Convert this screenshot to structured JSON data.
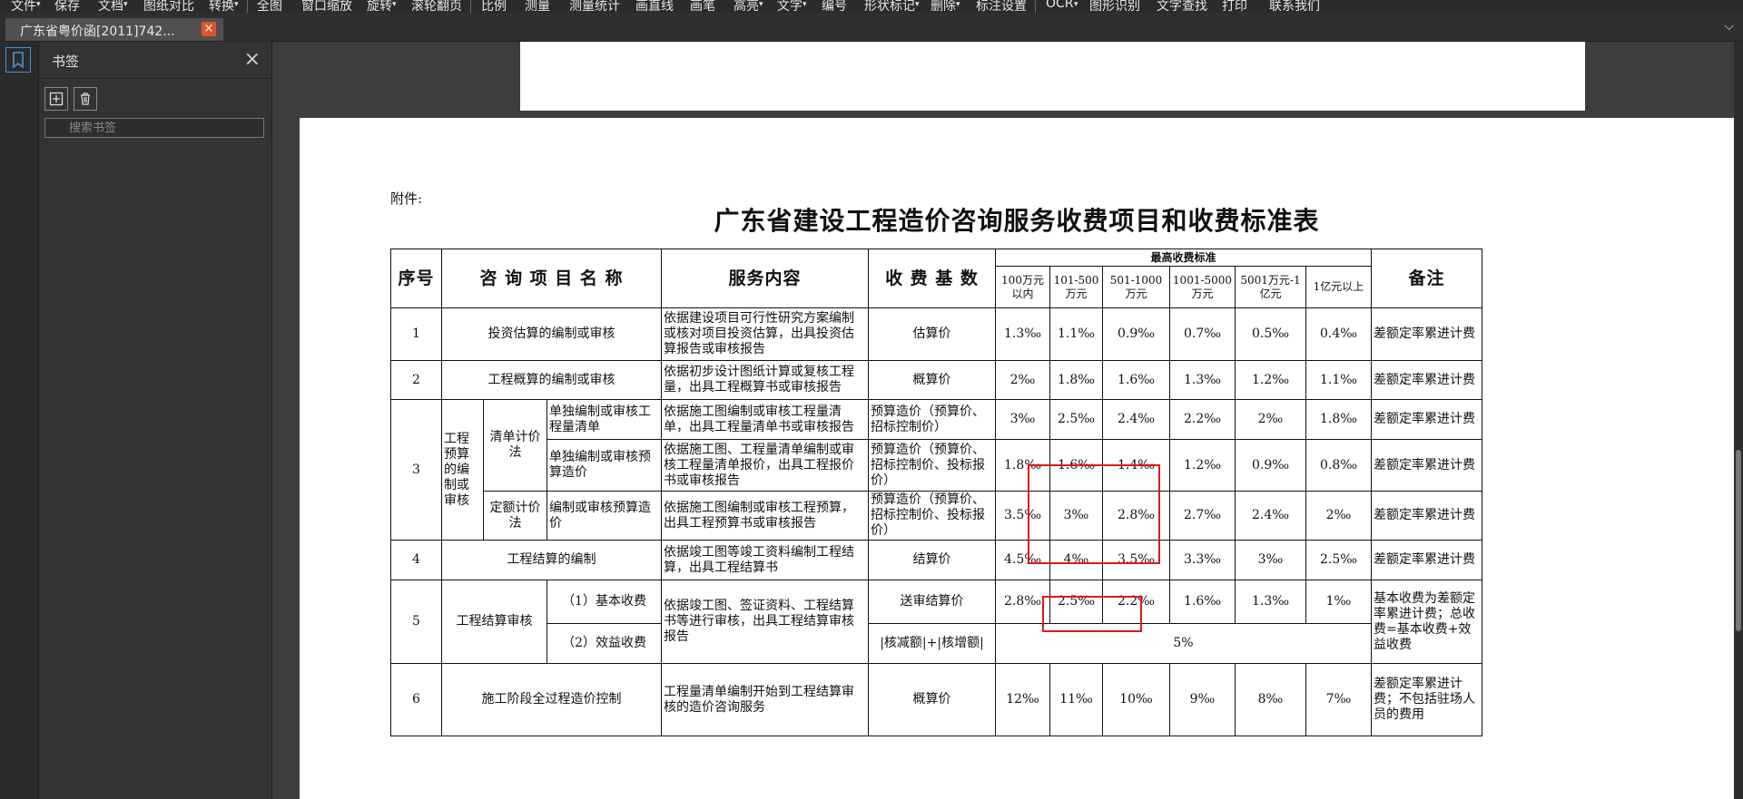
{
  "menu": [
    "文件",
    "保存",
    "文档",
    "图纸对比",
    "转换",
    "全图",
    "窗口缩放",
    "旋转",
    "滚轮翻页",
    "比例",
    "测量",
    "测量统计",
    "画直线",
    "画笔",
    "高亮",
    "文字",
    "编号",
    "形状标记",
    "删除",
    "标注设置",
    "OCR",
    "图形识别",
    "文字查找",
    "打印",
    "联系我们"
  ],
  "tab": {
    "title": "广东省粤价函[2011]742...",
    "close": "×"
  },
  "bookmark_panel": {
    "title": "书签",
    "close": "×",
    "search_placeholder": "搜索书签"
  },
  "document": {
    "attachment_label": "附件:",
    "title": "广东省建设工程造价咨询服务收费项目和收费标准表",
    "header": {
      "no": "序号",
      "item": "咨 询 项 目 名 称",
      "service": "服务内容",
      "base": "收 费 基 数",
      "max_std": "最高收费标准",
      "tiers": [
        "100万元以内",
        "101-500万元",
        "501-1000万元",
        "1001-5000万元",
        "5001万元-1亿元",
        "1亿元以上"
      ],
      "remark": "备注"
    },
    "rows": {
      "r1": {
        "no": "1",
        "item": "投资估算的编制或审核",
        "service": "依据建设项目可行性研究方案编制或核对项目投资估算，出具投资估算报告或审核报告",
        "base": "估算价",
        "rates": [
          "1.3‰",
          "1.1‰",
          "0.9‰",
          "0.7‰",
          "0.5‰",
          "0.4‰"
        ],
        "remark": "差额定率累进计费"
      },
      "r2": {
        "no": "2",
        "item": "工程概算的编制或审核",
        "service": "依据初步设计图纸计算或复核工程量，出具工程概算书或审核报告",
        "base": "概算价",
        "rates": [
          "2‰",
          "1.8‰",
          "1.6‰",
          "1.3‰",
          "1.2‰",
          "1.1‰"
        ],
        "remark": "差额定率累进计费"
      },
      "r3": {
        "no": "3",
        "group": "工程预算的编制或审核",
        "method1": "清单计价法",
        "method2": "定额计价法",
        "a": {
          "sub": "单独编制或审核工程量清单",
          "service": "依据施工图编制或审核工程量清单，出具工程量清单书或审核报告",
          "base": "预算造价（预算价、招标控制价）",
          "rates": [
            "3‰",
            "2.5‰",
            "2.4‰",
            "2.2‰",
            "2‰",
            "1.8‰"
          ],
          "remark": "差额定率累进计费"
        },
        "b": {
          "sub": "单独编制或审核预算造价",
          "service": "依据施工图、工程量清单编制或审核工程量清单报价，出具工程报价书或审核报告",
          "base": "预算造价（预算价、招标控制价、投标报价）",
          "rates": [
            "1.8‰",
            "1.6‰",
            "1.4‰",
            "1.2‰",
            "0.9‰",
            "0.8‰"
          ],
          "remark": "差额定率累进计费"
        },
        "c": {
          "sub": "编制或审核预算造价",
          "service": "依据施工图编制或审核工程预算，出具工程预算书或审核报告",
          "base": "预算造价（预算价、招标控制价、投标报价）",
          "rates": [
            "3.5‰",
            "3‰",
            "2.8‰",
            "2.7‰",
            "2.4‰",
            "2‰"
          ],
          "remark": "差额定率累进计费"
        }
      },
      "r4": {
        "no": "4",
        "item": "工程结算的编制",
        "service": "依据竣工图等竣工资料编制工程结算，出具工程结算书",
        "base": "结算价",
        "rates": [
          "4.5‰",
          "4‰",
          "3.5‰",
          "3.3‰",
          "3‰",
          "2.5‰"
        ],
        "remark": "差额定率累进计费"
      },
      "r5": {
        "no": "5",
        "item": "工程结算审核",
        "service": "依据竣工图、签证资料、工程结算书等进行审核，出具工程结算审核报告",
        "remark": "基本收费为差额定率累进计费；总收费=基本收费+效益收费",
        "a": {
          "sub": "（1）基本收费",
          "base": "送审结算价",
          "rates": [
            "2.8‰",
            "2.5‰",
            "2.2‰",
            "1.6‰",
            "1.3‰",
            "1‰"
          ]
        },
        "b": {
          "sub": "（2）效益收费",
          "base": "|核减额|+|核增额|",
          "rate": "5%"
        }
      },
      "r6": {
        "no": "6",
        "item": "施工阶段全过程造价控制",
        "service": "工程量清单编制开始到工程结算审核的造价咨询服务",
        "base": "概算价",
        "rates": [
          "12‰",
          "11‰",
          "10‰",
          "9‰",
          "8‰",
          "7‰"
        ],
        "remark": "差额定率累进计费；不包括驻场人员的费用"
      }
    },
    "trailing_remark": "驻场..."
  }
}
